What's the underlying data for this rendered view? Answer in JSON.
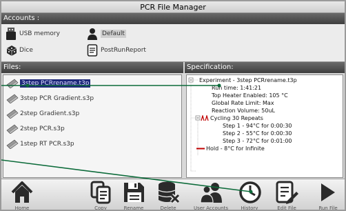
{
  "window": {
    "title": "PCR File Manager"
  },
  "accounts": {
    "header": "Accounts :",
    "items": [
      {
        "label": "USB memory",
        "icon": "usb-memory-icon"
      },
      {
        "label": "Default",
        "icon": "user-icon",
        "selected": true
      },
      {
        "label": "Dice",
        "icon": "dice-icon"
      },
      {
        "label": "PostRunReport",
        "icon": "document-icon"
      }
    ]
  },
  "files": {
    "header": "Files:",
    "items": [
      {
        "name": "3step PCRrename.t3p",
        "selected": true
      },
      {
        "name": "3step PCR Gradient.s3p"
      },
      {
        "name": "2step Gradient.s3p"
      },
      {
        "name": "2step PCR.s3p"
      },
      {
        "name": "1step RT PCR.s3p"
      }
    ]
  },
  "specification": {
    "header": "Specification:",
    "experiment": "Experiment - 3step PCRrename.t3p",
    "run_time": "Run time: 1:41:21",
    "top_heater": "Top Heater Enabled: 105 °C",
    "global_rate": "Global Rate Limit: Max",
    "reaction_volume": "Reaction Volume: 50uL",
    "cycling": "Cycling 30 Repeats",
    "steps": [
      "Step 1 - 94°C for 0:00:30",
      "Step 2 - 55°C for 0:00:30",
      "Step 3 - 72°C for 0:01:00"
    ],
    "hold": "Hold - 8°C for Infinite"
  },
  "toolbar": {
    "home": "Home",
    "copy": "Copy",
    "rename": "Rename",
    "delete": "Delete",
    "user_accounts": "User Accounts",
    "history": "History",
    "edit_file": "Edit File",
    "run_file": "Run File"
  },
  "colors": {
    "selection": "#1f2a7a",
    "header_dark": "#4a4a4a",
    "annotation_line": "#0c6b3a",
    "hold_red": "#c00000"
  }
}
